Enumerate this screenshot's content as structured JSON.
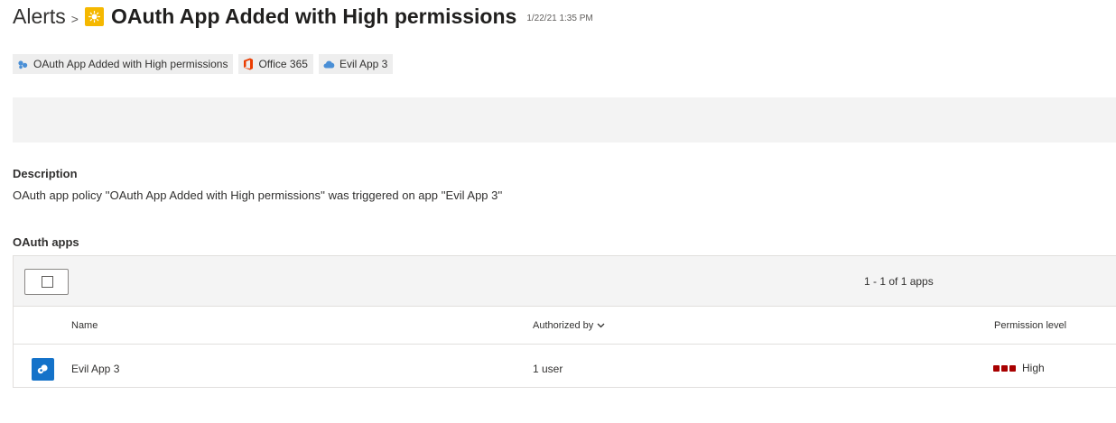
{
  "header": {
    "breadcrumb_root": "Alerts",
    "separator": ">",
    "title": "OAuth App Added with High permissions",
    "timestamp": "1/22/21 1:35 PM",
    "alert_icon": "sun-alert-icon",
    "alert_color": "#f5b800"
  },
  "tags": [
    {
      "label": "OAuth App Added with High permissions",
      "icon": "policy-icon"
    },
    {
      "label": "Office 365",
      "icon": "office-365-icon",
      "color": "#eb3c00"
    },
    {
      "label": "Evil App 3",
      "icon": "cloud-icon",
      "color": "#4a8fd6"
    }
  ],
  "description": {
    "label": "Description",
    "text": "OAuth app policy ''OAuth App Added with High permissions'' was triggered on app ''Evil App 3''"
  },
  "oauth_apps": {
    "label": "OAuth apps",
    "paging": "1 - 1 of 1 apps",
    "columns": {
      "name": "Name",
      "authorized_by": "Authorized by",
      "permission_level": "Permission level"
    },
    "rows": [
      {
        "name": "Evil App 3",
        "authorized_by": "1 user",
        "permission_level": "High",
        "permission_color": "#a80000",
        "icon": "app-icon"
      }
    ]
  }
}
